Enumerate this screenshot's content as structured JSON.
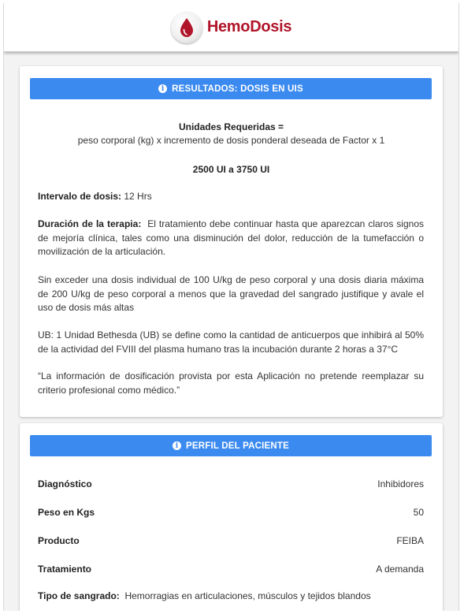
{
  "app": {
    "brand": "HemoDosis",
    "brand_color": "#b0152a",
    "accent_color": "#3b8af0"
  },
  "results": {
    "header": "RESULTADOS: DOSIS EN UIS",
    "formula_title": "Unidades Requeridas =",
    "formula": "peso corporal (kg) x incremento de dosis ponderal deseada de Factor x 1",
    "dose_range": "2500 UI a 3750 UI",
    "interval_label": "Intervalo de dosis:",
    "interval_value": "12 Hrs",
    "therapy_label": "Duración de la terapia:",
    "therapy_text": "El tratamiento debe continuar hasta que aparezcan claros signos de mejoría clínica, tales como una disminución del dolor, reducción de la tumefacción o movilización de la articulación.",
    "max_dose_text": "Sin exceder una dosis individual de 100 U/kg de peso corporal y una dosis diaria máxima de 200 U/kg de peso corporal a menos que la gravedad del sangrado justifique y avale el uso de dosis más altas",
    "ub_text": "UB: 1 Unidad Bethesda (UB) se define como la cantidad de anticuerpos que inhibirá al 50% de la actividad del FVIII del plasma humano tras la incubación durante 2 horas a 37°C",
    "disclaimer": "“La información de dosificación provista por esta Aplicación no pretende reemplazar su criterio profesional como médico.”"
  },
  "profile": {
    "header": "PERFIL DEL PACIENTE",
    "rows": [
      {
        "label": "Diagnóstico",
        "value": "Inhibidores"
      },
      {
        "label": "Peso en Kgs",
        "value": "50"
      },
      {
        "label": "Producto",
        "value": "FEIBA"
      },
      {
        "label": "Tratamiento",
        "value": "A demanda"
      }
    ],
    "bleed_label": "Tipo de sangrado:",
    "bleed_value": "Hemorragias en articulaciones, músculos y tejidos blandos"
  }
}
